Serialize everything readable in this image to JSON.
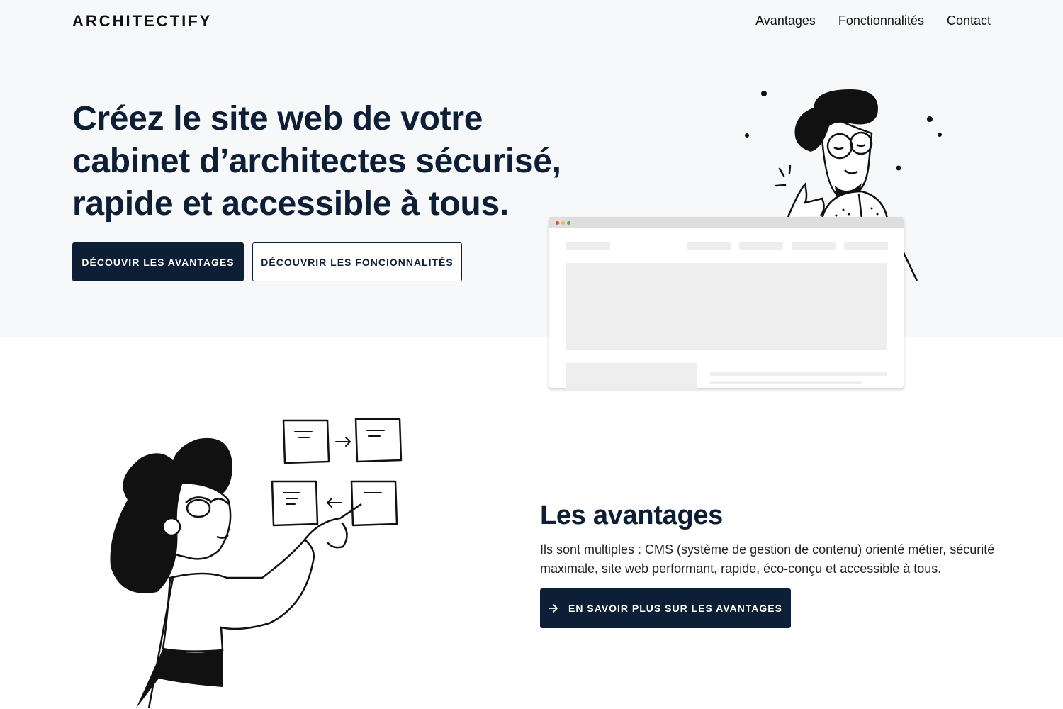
{
  "header": {
    "logo": "ARCHITECTIFY",
    "nav": [
      "Avantages",
      "Fonctionnalités",
      "Contact"
    ]
  },
  "hero": {
    "title": "Créez le site web de votre cabinet d’architectes sécurisé, rapide et accessible à tous.",
    "primary_button": "DÉCOUVIR LES AVANTAGES",
    "secondary_button": "DÉCOUVRIR LES FONCIONNALITÉS"
  },
  "advantages": {
    "title": "Les avantages",
    "text": "Ils sont multiples : CMS (système de gestion de contenu) orienté métier, sécurité maximale, site web performant, rapide, éco-conçu et accessible à tous.",
    "button": "EN SAVOIR PLUS SUR LES AVANTAGES",
    "button_icon": "arrow-right-icon"
  },
  "colors": {
    "primary": "#0d1f36",
    "hero_bg": "#f7f8fa"
  }
}
